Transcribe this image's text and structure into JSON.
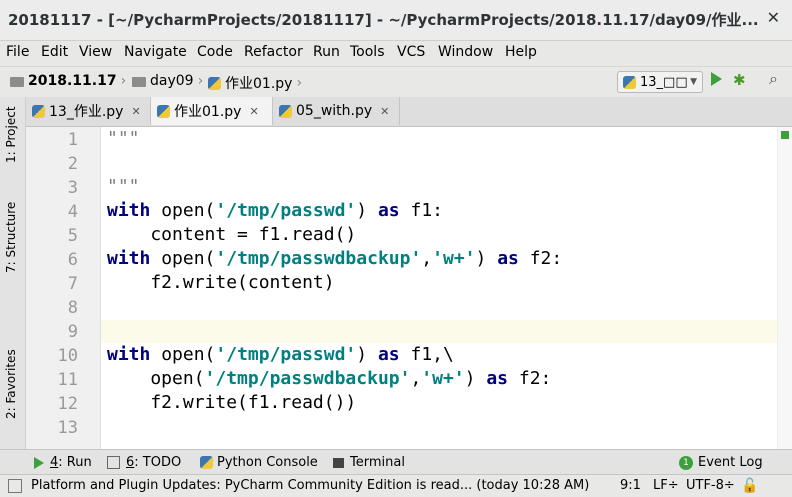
{
  "window": {
    "title": "20181117 - [~/PycharmProjects/20181117] - ~/PycharmProjects/2018.11.17/day09/作业..."
  },
  "menu": [
    "File",
    "Edit",
    "View",
    "Navigate",
    "Code",
    "Refactor",
    "Run",
    "Tools",
    "VCS",
    "Window",
    "Help"
  ],
  "breadcrumb": {
    "project": "2018.11.17",
    "folder": "day09",
    "file": "作业01.py"
  },
  "run_config": "13_□□",
  "side_tabs": {
    "project": "1: Project",
    "structure": "7: Structure",
    "favorites": "2: Favorites"
  },
  "tabs": [
    {
      "label": "13_作业.py",
      "active": false
    },
    {
      "label": "作业01.py",
      "active": true
    },
    {
      "label": "05_with.py",
      "active": false
    }
  ],
  "editor": {
    "line_numbers": [
      "1",
      "2",
      "3",
      "4",
      "5",
      "6",
      "7",
      "8",
      "9",
      "10",
      "11",
      "12",
      "13"
    ],
    "current_line": 9,
    "code": {
      "l1": "\"\"\"",
      "l3": "\"\"\"",
      "with": "with",
      "open": " open(",
      "as": "as",
      "passwd": "'/tmp/passwd'",
      "backup": "'/tmp/passwdbackup'",
      "wplus": "'w+'",
      "l4_tail": " f1:",
      "l5": "    content = f1.read()",
      "l6_tail": " f2:",
      "l7": "    f2.write(content)",
      "l10_tail": " f1,\\",
      "l11_open": "    open(",
      "l11_tail": " f2:",
      "l12": "    f2.write(f1.read())",
      "comma": ",",
      "rparen": ") "
    }
  },
  "tool_windows": [
    {
      "key": "4",
      "label": ": Run"
    },
    {
      "key": "6",
      "label": ": TODO"
    },
    {
      "key": "",
      "label": "Python Console"
    },
    {
      "key": "",
      "label": "Terminal"
    }
  ],
  "event_log": {
    "count": "1",
    "label": "Event Log"
  },
  "status": {
    "message": "Platform and Plugin Updates: PyCharm Community Edition is read... (today 10:28 AM)",
    "position": "9:1",
    "line_sep": "LF÷",
    "encoding": "UTF-8÷"
  }
}
